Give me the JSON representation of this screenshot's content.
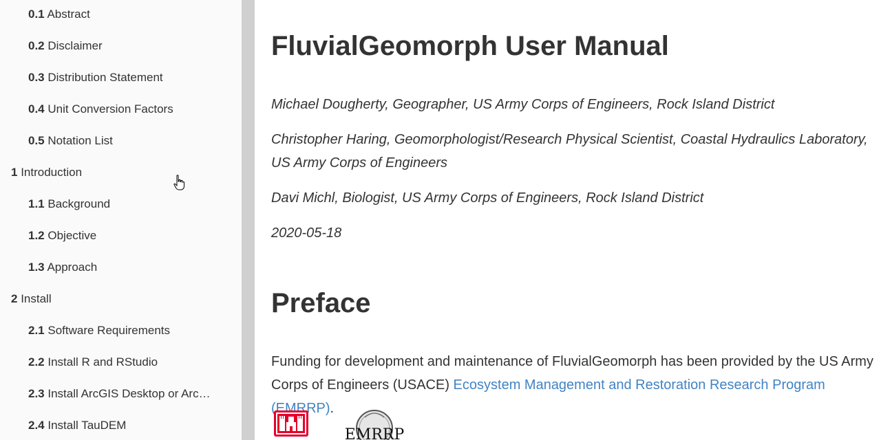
{
  "toc": [
    {
      "num": "0.1",
      "label": "Abstract",
      "level": 2
    },
    {
      "num": "0.2",
      "label": "Disclaimer",
      "level": 2
    },
    {
      "num": "0.3",
      "label": "Distribution Statement",
      "level": 2
    },
    {
      "num": "0.4",
      "label": "Unit Conversion Factors",
      "level": 2
    },
    {
      "num": "0.5",
      "label": "Notation List",
      "level": 2
    },
    {
      "num": "1",
      "label": "Introduction",
      "level": 1
    },
    {
      "num": "1.1",
      "label": "Background",
      "level": 2
    },
    {
      "num": "1.2",
      "label": "Objective",
      "level": 2
    },
    {
      "num": "1.3",
      "label": "Approach",
      "level": 2
    },
    {
      "num": "2",
      "label": "Install",
      "level": 1
    },
    {
      "num": "2.1",
      "label": "Software Requirements",
      "level": 2
    },
    {
      "num": "2.2",
      "label": "Install R and RStudio",
      "level": 2
    },
    {
      "num": "2.3",
      "label": "Install ArcGIS Desktop or Arc…",
      "level": 2
    },
    {
      "num": "2.4",
      "label": "Install TauDEM",
      "level": 2
    }
  ],
  "document": {
    "title": "FluvialGeomorph User Manual",
    "authors": [
      "Michael Dougherty, Geographer, US Army Corps of Engineers, Rock Island District",
      "Christopher Haring, Geomorphologist/Research Physical Scientist, Coastal Hydraulics Laboratory, US Army Corps of Engineers",
      "Davi Michl, Biologist, US Army Corps of Engineers, Rock Island District"
    ],
    "date": "2020-05-18",
    "preface": {
      "heading": "Preface",
      "text_before": "Funding for development and maintenance of FluvialGeomorph has been provided by the US Army Corps of Engineers (USACE) ",
      "link_text": "Ecosystem Management and Restoration Research Program (EMRRP)",
      "text_after": "."
    },
    "logos": {
      "emrrp_logo_text": "EMRRP"
    }
  },
  "colors": {
    "link": "#4183c4",
    "sidebar_bg": "#fafafa",
    "divider": "#d0d0d0",
    "usace_red": "#e4002b"
  }
}
